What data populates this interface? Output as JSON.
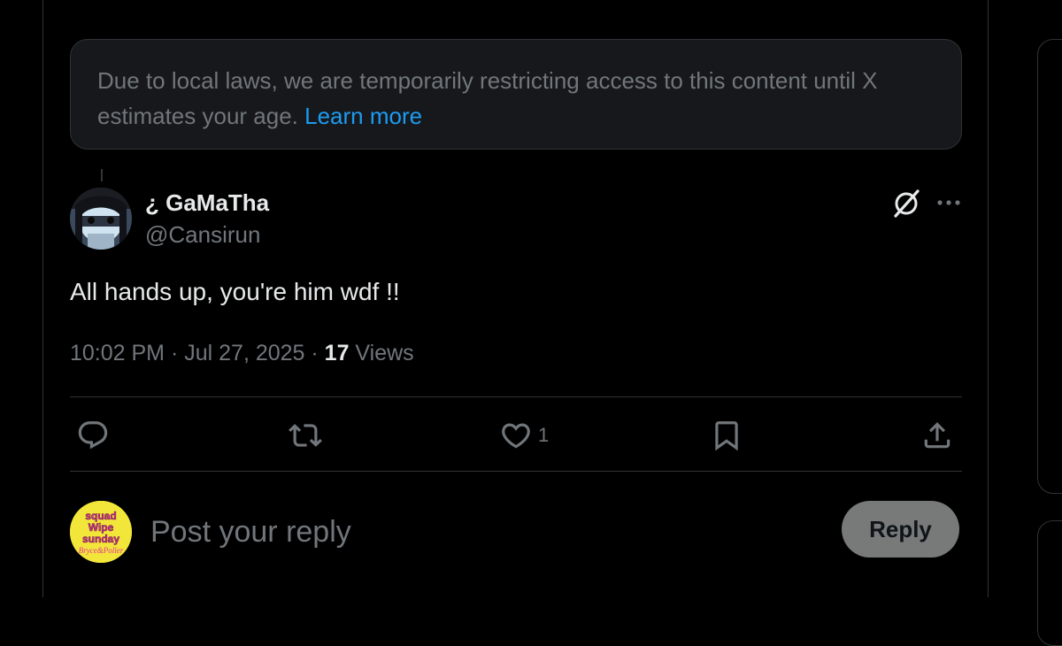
{
  "notice": {
    "text": "Due to local laws, we are temporarily restricting access to this content until X estimates your age. ",
    "link_label": "Learn more"
  },
  "post": {
    "author_name": "¿ GaMaTha",
    "author_handle": "@Cansirun",
    "text": "All hands up, you're him wdf !!",
    "time": "10:02 PM",
    "separator": " · ",
    "date": "Jul 27, 2025",
    "views_count": "17",
    "views_label": " Views"
  },
  "actions": {
    "reply_icon": "reply-icon",
    "repost_icon": "repost-icon",
    "like_icon": "heart-icon",
    "like_count": "1",
    "bookmark_icon": "bookmark-icon",
    "share_icon": "share-icon"
  },
  "composer": {
    "placeholder": "Post your reply",
    "avatar_text": [
      "squad",
      "Wipe",
      "sunday"
    ],
    "avatar_script": "Bryce&Poller",
    "reply_button": "Reply"
  },
  "colors": {
    "background": "#000000",
    "notice_bg": "#16181c",
    "link": "#1d9bf0",
    "muted": "#71767b",
    "text": "#e7e9ea",
    "reply_button_bg": "#787a7a"
  }
}
